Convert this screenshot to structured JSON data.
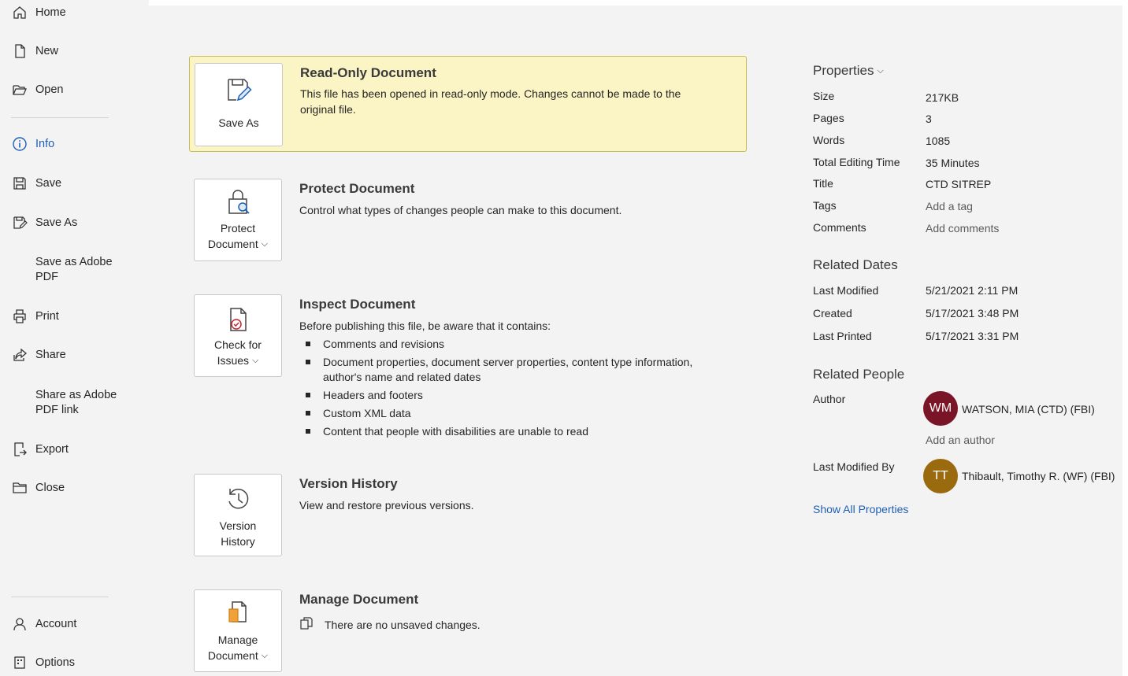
{
  "sidebar": {
    "items": [
      {
        "label": "Home",
        "icon": "home-icon"
      },
      {
        "label": "New",
        "icon": "new-document-icon"
      },
      {
        "label": "Open",
        "icon": "folder-open-icon"
      },
      {
        "label": "Info",
        "icon": "info-icon",
        "active": true
      },
      {
        "label": "Save",
        "icon": "save-icon"
      },
      {
        "label": "Save As",
        "icon": "save-as-icon"
      },
      {
        "label": "Save as Adobe PDF",
        "icon": ""
      },
      {
        "label": "Print",
        "icon": "printer-icon"
      },
      {
        "label": "Share",
        "icon": "share-icon"
      },
      {
        "label": "Share as Adobe PDF link",
        "icon": ""
      },
      {
        "label": "Export",
        "icon": "export-icon"
      },
      {
        "label": "Close",
        "icon": "folder-close-icon"
      }
    ],
    "bottom": [
      {
        "label": "Account",
        "icon": "person-icon"
      },
      {
        "label": "Options",
        "icon": "options-icon"
      }
    ],
    "active_color": "#1f5fb4"
  },
  "sections": {
    "read_only": {
      "tile_label": "Save As",
      "title": "Read-Only Document",
      "description": "This file has been opened in read-only mode. Changes cannot be made to the original file.",
      "banner_color": "#fbf4c4"
    },
    "protect": {
      "tile_label_line1": "Protect",
      "tile_label_line2": "Document",
      "title": "Protect Document",
      "description": "Control what types of changes people can make to this document."
    },
    "inspect": {
      "tile_label_line1": "Check for",
      "tile_label_line2": "Issues",
      "title": "Inspect Document",
      "description": "Before publishing this file, be aware that it contains:",
      "bullets": [
        "Comments and revisions",
        "Document properties, document server properties, content type information, author's name and related dates",
        "Headers and footers",
        "Custom XML data",
        "Content that people with disabilities are unable to read"
      ]
    },
    "version": {
      "tile_label_line1": "Version",
      "tile_label_line2": "History",
      "title": "Version History",
      "description": "View and restore previous versions."
    },
    "manage": {
      "tile_label_line1": "Manage",
      "tile_label_line2": "Document",
      "title": "Manage Document",
      "description": "There are no unsaved changes."
    }
  },
  "properties": {
    "header": "Properties",
    "rows": [
      {
        "key": "Size",
        "value": "217KB"
      },
      {
        "key": "Pages",
        "value": "3"
      },
      {
        "key": "Words",
        "value": "1085"
      },
      {
        "key": "Total Editing Time",
        "value": "35 Minutes"
      },
      {
        "key": "Title",
        "value": "CTD SITREP"
      },
      {
        "key": "Tags",
        "value": "Add a tag"
      },
      {
        "key": "Comments",
        "value": "Add comments"
      }
    ],
    "related_dates_header": "Related Dates",
    "dates": [
      {
        "key": "Last Modified",
        "value": "5/21/2021 2:11 PM"
      },
      {
        "key": "Created",
        "value": "5/17/2021 3:48 PM"
      },
      {
        "key": "Last Printed",
        "value": "5/17/2021 3:31 PM"
      }
    ],
    "related_people_header": "Related People",
    "author_label": "Author",
    "author": {
      "initials": "WM",
      "name": "WATSON, MIA (CTD) (FBI)",
      "color": "#7a1527"
    },
    "add_author": "Add an author",
    "last_modified_by_label": "Last Modified By",
    "last_modified_by": {
      "initials": "TT",
      "name": "Thibault, Timothy R. (WF) (FBI)",
      "color": "#9a6a0e"
    },
    "show_all": "Show All Properties"
  }
}
